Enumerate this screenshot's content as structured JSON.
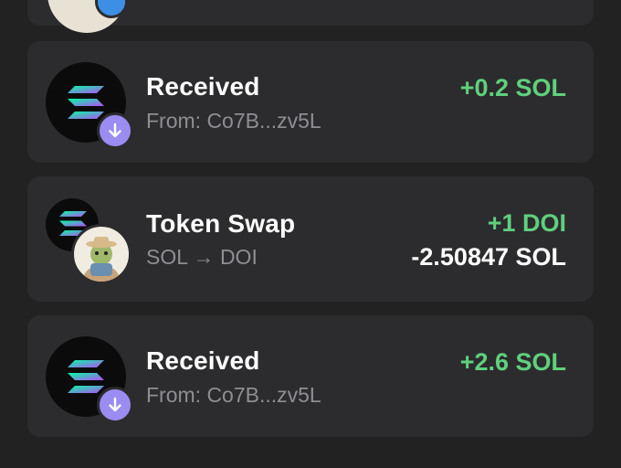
{
  "transactions": [
    {
      "title": "Received",
      "subtitle": "From: Co7B...zv5L",
      "amount": "+0.2 SOL"
    },
    {
      "title": "Token Swap",
      "subtitle": "SOL → DOI",
      "amount_in": "+1 DOI",
      "amount_out": "-2.50847 SOL"
    },
    {
      "title": "Received",
      "subtitle": "From: Co7B...zv5L",
      "amount": "+2.6 SOL"
    }
  ],
  "icons": {
    "solana": "solana-logo-icon",
    "receive": "arrow-down-icon",
    "token": "doi-token-icon"
  },
  "colors": {
    "positive": "#5fd07e",
    "neutral": "#ffffff",
    "badge": "#9b8cf2"
  }
}
